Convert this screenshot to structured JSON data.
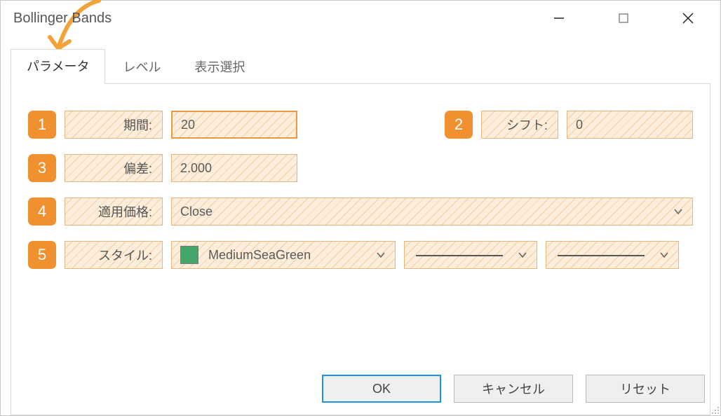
{
  "window": {
    "title": "Bollinger Bands"
  },
  "tabs": {
    "t0": "パラメータ",
    "t1": "レベル",
    "t2": "表示選択"
  },
  "badges": {
    "b1": "1",
    "b2": "2",
    "b3": "3",
    "b4": "4",
    "b5": "5"
  },
  "labels": {
    "period": "期間:",
    "shift": "シフト:",
    "deviation": "偏差:",
    "apply_price": "適用価格:",
    "style": "スタイル:"
  },
  "values": {
    "period": "20",
    "shift": "0",
    "deviation": "2.000",
    "apply_price": "Close",
    "color_name": "MediumSeaGreen",
    "color_hex": "#44a56a"
  },
  "buttons": {
    "ok": "OK",
    "cancel": "キャンセル",
    "reset": "リセット"
  }
}
